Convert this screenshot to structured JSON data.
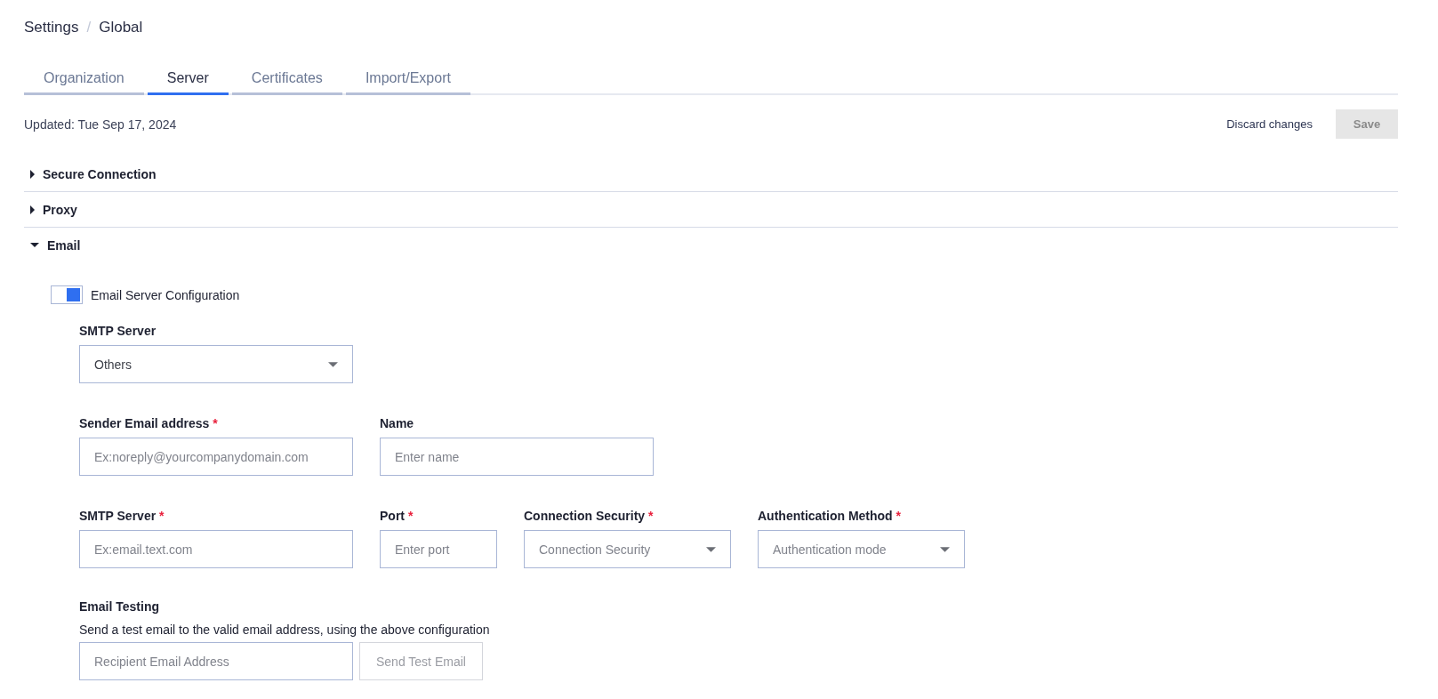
{
  "breadcrumb": {
    "items": [
      "Settings",
      "Global"
    ],
    "separator": "/"
  },
  "tabs": [
    {
      "label": "Organization",
      "selected": false
    },
    {
      "label": "Server",
      "selected": true
    },
    {
      "label": "Certificates",
      "selected": false
    },
    {
      "label": "Import/Export",
      "selected": false
    }
  ],
  "updated": "Updated: Tue Sep 17, 2024",
  "actions": {
    "discard": "Discard changes",
    "save": {
      "label": "Save",
      "disabled": true
    }
  },
  "sections": [
    {
      "title": "Secure Connection",
      "expanded": false
    },
    {
      "title": "Proxy",
      "expanded": false
    },
    {
      "title": "Email",
      "expanded": true
    }
  ],
  "email": {
    "toggle": {
      "label": "Email Server Configuration",
      "on": true
    },
    "rows": [
      [
        {
          "kind": "select",
          "label": "SMTP Server",
          "value": "Others"
        }
      ],
      [
        {
          "kind": "text",
          "label": "Sender Email address",
          "required_mark": "*",
          "placeholder": "Ex:noreply@yourcompanydomain.com"
        },
        {
          "kind": "text",
          "label": "Name",
          "placeholder": "Enter name"
        }
      ],
      [
        {
          "kind": "text",
          "label": "SMTP Server",
          "required_mark": "*",
          "placeholder": "Ex:email.text.com"
        },
        {
          "kind": "text",
          "label": "Port",
          "required_mark": "*",
          "placeholder": "Enter port"
        },
        {
          "kind": "select",
          "label": "Connection Security",
          "required_mark": "*",
          "placeholder": "Connection Security"
        },
        {
          "kind": "select",
          "label": "Authentication Method",
          "required_mark": "*",
          "placeholder": "Authentication mode"
        }
      ]
    ],
    "testing": {
      "title": "Email Testing",
      "description": "Send a test email to the valid email address, using the above configuration",
      "placeholder": "Recipient Email Address",
      "button": {
        "label": "Send Test Email",
        "disabled": true
      }
    }
  }
}
